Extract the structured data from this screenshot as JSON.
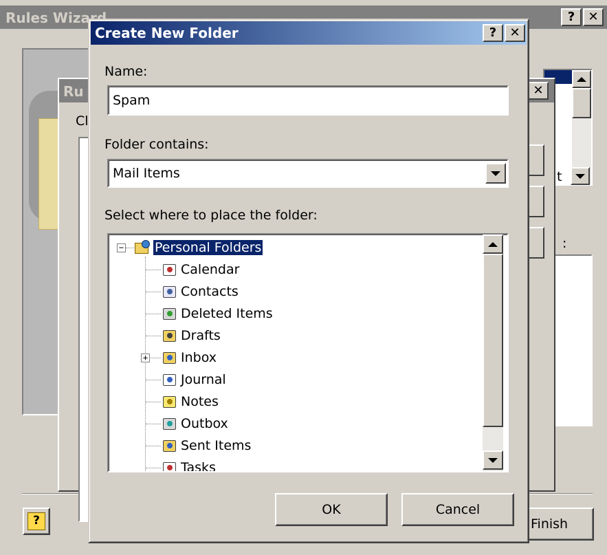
{
  "rules_wizard": {
    "title": "Rules Wizard",
    "finish_label": "Finish",
    "help_icon": "help-book-icon"
  },
  "inner_dialog": {
    "title_fragment": "Ru",
    "label_fragment": "Cl",
    "dropdown_fragment": "t",
    "colon_fragment": ":"
  },
  "create_folder": {
    "title": "Create New Folder",
    "help_glyph": "?",
    "close_glyph": "✕",
    "name_label": "Name:",
    "name_value": "Spam",
    "contains_label": "Folder contains:",
    "contains_value": "Mail Items",
    "place_label": "Select where to place the folder:",
    "ok_label": "OK",
    "cancel_label": "Cancel"
  },
  "tree": {
    "root": {
      "label": "Personal Folders",
      "icon": "personal-folders-icon",
      "selected": true
    },
    "items": [
      {
        "label": "Calendar",
        "icon": "calendar-icon"
      },
      {
        "label": "Contacts",
        "icon": "contacts-icon"
      },
      {
        "label": "Deleted Items",
        "icon": "deleted-items-icon"
      },
      {
        "label": "Drafts",
        "icon": "drafts-icon"
      },
      {
        "label": "Inbox",
        "icon": "inbox-icon",
        "expandable": true
      },
      {
        "label": "Journal",
        "icon": "journal-icon"
      },
      {
        "label": "Notes",
        "icon": "notes-icon"
      },
      {
        "label": "Outbox",
        "icon": "outbox-icon"
      },
      {
        "label": "Sent Items",
        "icon": "sent-items-icon"
      },
      {
        "label": "Tasks",
        "icon": "tasks-icon"
      }
    ]
  },
  "colors": {
    "title_active_start": "#0a246a",
    "title_active_end": "#a6caf0",
    "title_inactive": "#808080",
    "selection": "#0a246a",
    "face": "#d4d0c8"
  }
}
